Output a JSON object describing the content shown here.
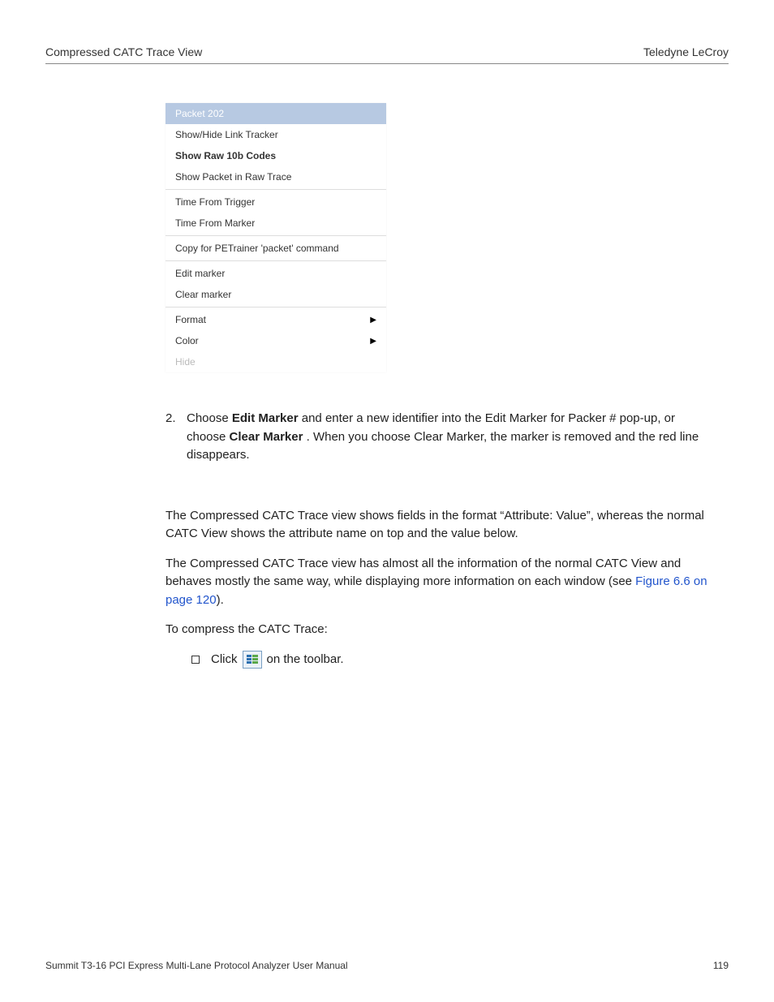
{
  "header": {
    "left": "Compressed CATC Trace View",
    "right": "Teledyne LeCroy"
  },
  "menu": {
    "title": "Packet 202",
    "items": [
      {
        "label": "Show/Hide Link Tracker"
      },
      {
        "label": "Show Raw 10b Codes"
      },
      {
        "label": "Show Packet in Raw Trace"
      },
      {
        "label": "Time From Trigger"
      },
      {
        "label": "Time From Marker"
      },
      {
        "label": "Copy for PETrainer 'packet' command"
      },
      {
        "label": "Edit marker"
      },
      {
        "label": "Clear marker"
      },
      {
        "label": "Format",
        "submenu": true
      },
      {
        "label": "Color",
        "submenu": true
      },
      {
        "label": "Hide",
        "disabled": true
      }
    ]
  },
  "step": {
    "number": "2.",
    "t1": "Choose ",
    "b1": "Edit Marker",
    "t2": " and enter a new identifier into the Edit Marker for Packer # pop-up, or",
    "t3": "choose ",
    "b2": "Clear Marker",
    "t4": ". When you choose Clear Marker, the marker is removed and the red line disappears."
  },
  "paras": {
    "0": "The Compressed CATC Trace view shows fields in the format “Attribute: Value”, whereas the normal CATC View shows the attribute name on top and the value below.",
    "1a": "The Compressed CATC Trace view has almost all the information of the normal CATC View and behaves mostly the same way, while displaying more information on each window (see ",
    "link": "Figure 6.6 on page 120",
    "1b": ").",
    "2": "To compress the CATC Trace:"
  },
  "bullet": {
    "before": "Click",
    "after": "on the toolbar."
  },
  "footer": {
    "left": "Summit T3-16 PCI Express Multi-Lane Protocol Analyzer User Manual",
    "right": "119"
  }
}
